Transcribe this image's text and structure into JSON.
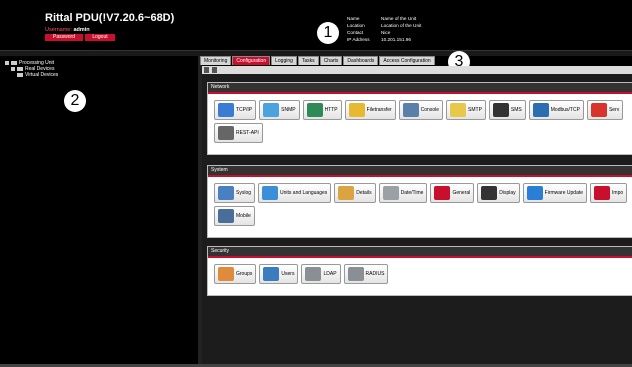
{
  "header": {
    "title": "Rittal PDU(!V7.20.6~68D)",
    "username_label": "Username:",
    "username": "admin",
    "password_button": "Password",
    "logout_button": "Logout"
  },
  "device_info": [
    {
      "key": "Name",
      "value": "Name of the Unit"
    },
    {
      "key": "Location",
      "value": "Location of the Unit"
    },
    {
      "key": "Contact",
      "value": "Nice"
    },
    {
      "key": "IP Address",
      "value": "10.201.151.96"
    }
  ],
  "callouts": [
    "1",
    "2",
    "3"
  ],
  "tree": {
    "items": [
      {
        "label": "Processing Unit",
        "level": 0
      },
      {
        "label": "Real Devices",
        "level": 1
      },
      {
        "label": "Virtual Devices",
        "level": 1
      }
    ]
  },
  "tabs": [
    "Monitoring",
    "Configuration",
    "Logging",
    "Tasks",
    "Charts",
    "Dashboards",
    "Access Configuration"
  ],
  "active_tab": "Configuration",
  "panels": {
    "network": {
      "title": "Network",
      "items": [
        {
          "label": "TCP/IP",
          "icon": "network-plug-icon",
          "color": "#3a7bd5"
        },
        {
          "label": "SNMP",
          "icon": "database-icon",
          "color": "#4aa3df"
        },
        {
          "label": "HTTP",
          "icon": "globe-icon",
          "color": "#2e8b57"
        },
        {
          "label": "Filetransfer",
          "icon": "folder-icon",
          "color": "#e8b830"
        },
        {
          "label": "Console",
          "icon": "monitor-icon",
          "color": "#5a7fa8"
        },
        {
          "label": "SMTP",
          "icon": "envelope-icon",
          "color": "#e8c84a"
        },
        {
          "label": "SMS",
          "icon": "phone-icon",
          "color": "#333333"
        },
        {
          "label": "Modbus/TCP",
          "icon": "modbus-icon",
          "color": "#2a6db0"
        },
        {
          "label": "Serv",
          "icon": "power-icon",
          "color": "#d9342b"
        },
        {
          "label": "REST-API",
          "icon": "rest-api-icon",
          "color": "#666666"
        }
      ]
    },
    "system": {
      "title": "System",
      "items": [
        {
          "label": "Syslog",
          "icon": "chart-icon",
          "color": "#4a7fc1"
        },
        {
          "label": "Units and Languages",
          "icon": "flag-icon",
          "color": "#3b8fd9"
        },
        {
          "label": "Details",
          "icon": "details-icon",
          "color": "#d9a441"
        },
        {
          "label": "Date/Time",
          "icon": "clock-icon",
          "color": "#9aa0a6"
        },
        {
          "label": "General",
          "icon": "wrench-icon",
          "color": "#c8102e"
        },
        {
          "label": "Display",
          "icon": "display-icon",
          "color": "#333333"
        },
        {
          "label": "Firmware Update",
          "icon": "refresh-icon",
          "color": "#2a7fd4"
        },
        {
          "label": "Impo",
          "icon": "tools-icon",
          "color": "#c8102e"
        },
        {
          "label": "Mobile",
          "icon": "tablet-icon",
          "color": "#4a6e9a"
        }
      ]
    },
    "security": {
      "title": "Security",
      "items": [
        {
          "label": "Groups",
          "icon": "group-icon",
          "color": "#e08a3c"
        },
        {
          "label": "Users",
          "icon": "user-icon",
          "color": "#3b7bbf"
        },
        {
          "label": "LDAP",
          "icon": "lock-icon",
          "color": "#8a8f96"
        },
        {
          "label": "RADIUS",
          "icon": "lock-icon",
          "color": "#8a8f96"
        }
      ]
    }
  }
}
